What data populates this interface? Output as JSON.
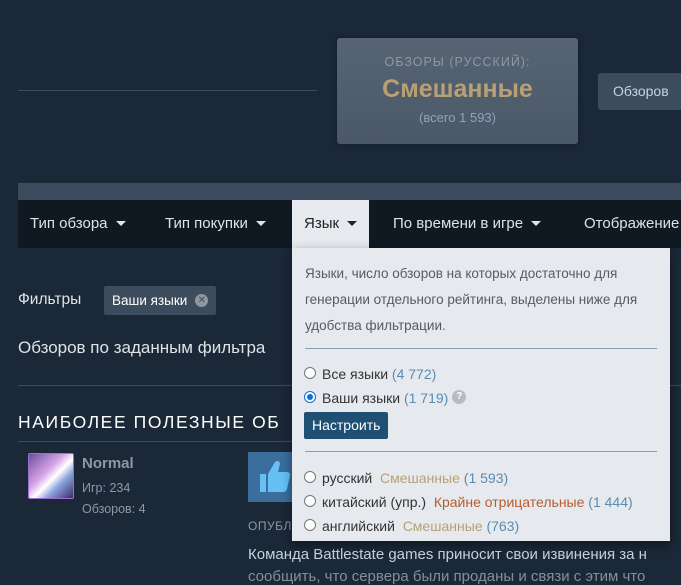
{
  "summary": {
    "caption": "ОБЗОРЫ (РУССКИЙ):",
    "rating": "Смешанные",
    "total": "(всего 1 593)",
    "reviews_button": "Обзоров"
  },
  "filter_bar": {
    "items": [
      {
        "label": "Тип обзора"
      },
      {
        "label": "Тип покупки"
      },
      {
        "label": "Язык"
      },
      {
        "label": "По времени в игре"
      },
      {
        "label": "Отображение"
      }
    ]
  },
  "filters": {
    "label": "Фильтры",
    "chip": "Ваши языки",
    "count_line": "Обзоров по заданным фильтра"
  },
  "section": {
    "title": "НАИБОЛЕЕ ПОЛЕЗНЫЕ ОБ"
  },
  "review": {
    "author": "Normal",
    "games": "Игр: 234",
    "reviews": "Обзоров: 4",
    "posted": "ОПУБЛ",
    "text_line1": "Команда Battlestate games приносит свои извинения за н",
    "text_line2": "сообщить, что сервера были проданы и связи с этим что"
  },
  "language_dropdown": {
    "description": "Языки, число обзоров на которых достаточно для генерации отдельного рейтинга, выделены ниже для удобства фильтрации.",
    "all_languages": {
      "label": "Все языки",
      "count": "(4 772)"
    },
    "your_languages": {
      "label": "Ваши языки",
      "count": "(1 719)"
    },
    "help": "?",
    "customize_button": "Настроить",
    "languages": [
      {
        "name": "русский",
        "rating": "Смешанные",
        "count": "(1 593)"
      },
      {
        "name": "китайский (упр.)",
        "rating": "Крайне отрицательные",
        "count": "(1 444)"
      },
      {
        "name": "английский",
        "rating": "Смешанные",
        "count": "(763)"
      }
    ]
  },
  "colors": {
    "background": "#1b2838",
    "mixed": "#b9a074",
    "negative": "#b85c2c",
    "dropdown_bg": "#e6eaee",
    "button_blue": "#1f4f73"
  }
}
